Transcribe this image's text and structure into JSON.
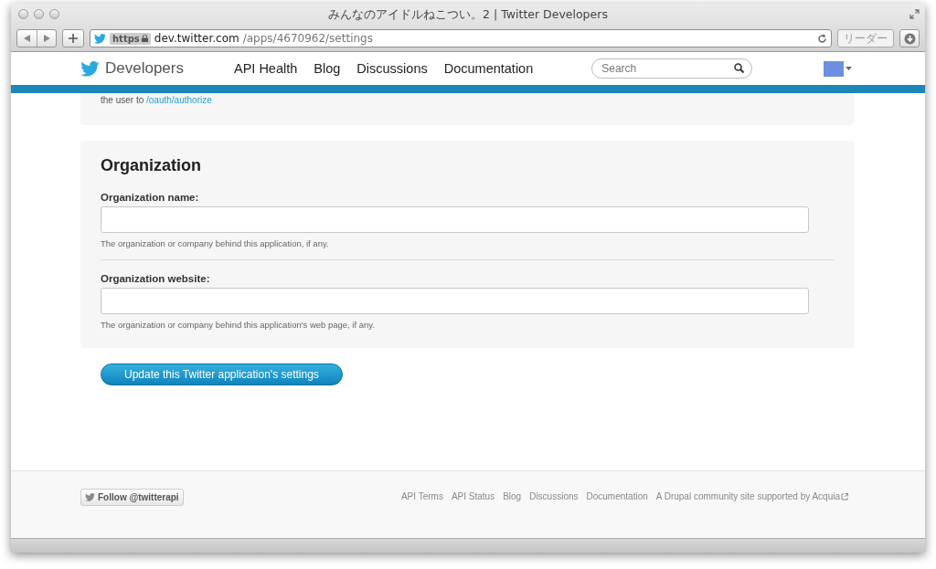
{
  "window": {
    "title": "みんなのアイドルねこつい。2 | Twitter Developers"
  },
  "toolbar": {
    "scheme": "https",
    "host": "dev.twitter.com",
    "path": "/apps/4670962/settings",
    "reader": "リーダー"
  },
  "nav": {
    "brand": "Developers",
    "links": [
      "API Health",
      "Blog",
      "Discussions",
      "Documentation"
    ],
    "search": {
      "placeholder": "Search"
    }
  },
  "previous_section": {
    "text": "the user to ",
    "link": "/oauth/authorize"
  },
  "organization": {
    "heading": "Organization",
    "fields": [
      {
        "label": "Organization name:",
        "help": "The organization or company behind this application, if any."
      },
      {
        "label": "Organization website:",
        "help": "The organization or company behind this application's web page, if any."
      }
    ]
  },
  "submit_button": "Update this Twitter application's settings",
  "footer": {
    "follow_button": "Follow @twitterapi",
    "links": [
      "API Terms",
      "API Status",
      "Blog",
      "Discussions",
      "Documentation",
      "A Drupal community site supported by Acquia"
    ]
  }
}
